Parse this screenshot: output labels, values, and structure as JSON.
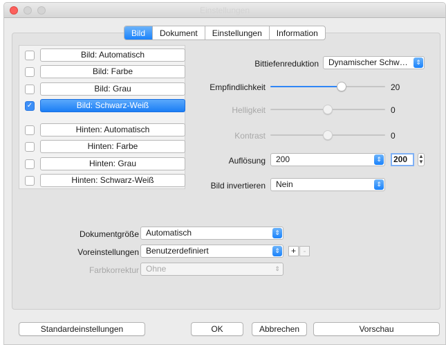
{
  "window": {
    "title": "Einstellungen"
  },
  "tabs": [
    {
      "label": "Bild",
      "active": true
    },
    {
      "label": "Dokument",
      "active": false
    },
    {
      "label": "Einstellungen",
      "active": false
    },
    {
      "label": "Information",
      "active": false
    }
  ],
  "image_list": [
    {
      "label": "Bild: Automatisch",
      "checked": false,
      "selected": false
    },
    {
      "label": "Bild: Farbe",
      "checked": false,
      "selected": false
    },
    {
      "label": "Bild: Grau",
      "checked": false,
      "selected": false
    },
    {
      "label": "Bild: Schwarz-Weiß",
      "checked": true,
      "selected": true
    },
    {
      "label": "Hinten: Automatisch",
      "checked": false,
      "selected": false
    },
    {
      "label": "Hinten: Farbe",
      "checked": false,
      "selected": false
    },
    {
      "label": "Hinten: Grau",
      "checked": false,
      "selected": false
    },
    {
      "label": "Hinten: Schwarz-Weiß",
      "checked": false,
      "selected": false
    }
  ],
  "settings": {
    "bit_depth": {
      "label": "Bittiefenreduktion",
      "value": "Dynamischer Schw…"
    },
    "sensitivity": {
      "label": "Empfindlichkeit",
      "value": "20",
      "level": 0.63,
      "enabled": true
    },
    "brightness": {
      "label": "Helligkeit",
      "value": "0",
      "level": 0.5,
      "enabled": false
    },
    "contrast": {
      "label": "Kontrast",
      "value": "0",
      "level": 0.5,
      "enabled": false
    },
    "resolution": {
      "label": "Auflösung",
      "value": "200",
      "field_value": "200"
    },
    "invert": {
      "label": "Bild invertieren",
      "value": "Nein"
    }
  },
  "document": {
    "size": {
      "label": "Dokumentgröße",
      "value": "Automatisch"
    },
    "presets": {
      "label": "Voreinstellungen",
      "value": "Benutzerdefiniert",
      "add": "+",
      "remove": "-"
    },
    "color_correction": {
      "label": "Farbkorrektur",
      "value": "Ohne"
    }
  },
  "buttons": {
    "defaults": "Standardeinstellungen",
    "ok": "OK",
    "cancel": "Abbrechen",
    "preview": "Vorschau"
  },
  "icons": {
    "popup_arrows": "up-down-arrows-icon",
    "checkbox_check": "checkmark-icon",
    "stepper": "stepper-arrows-icon"
  },
  "colors": {
    "accent": "#1a82fb",
    "close_light": "#fc605c"
  }
}
